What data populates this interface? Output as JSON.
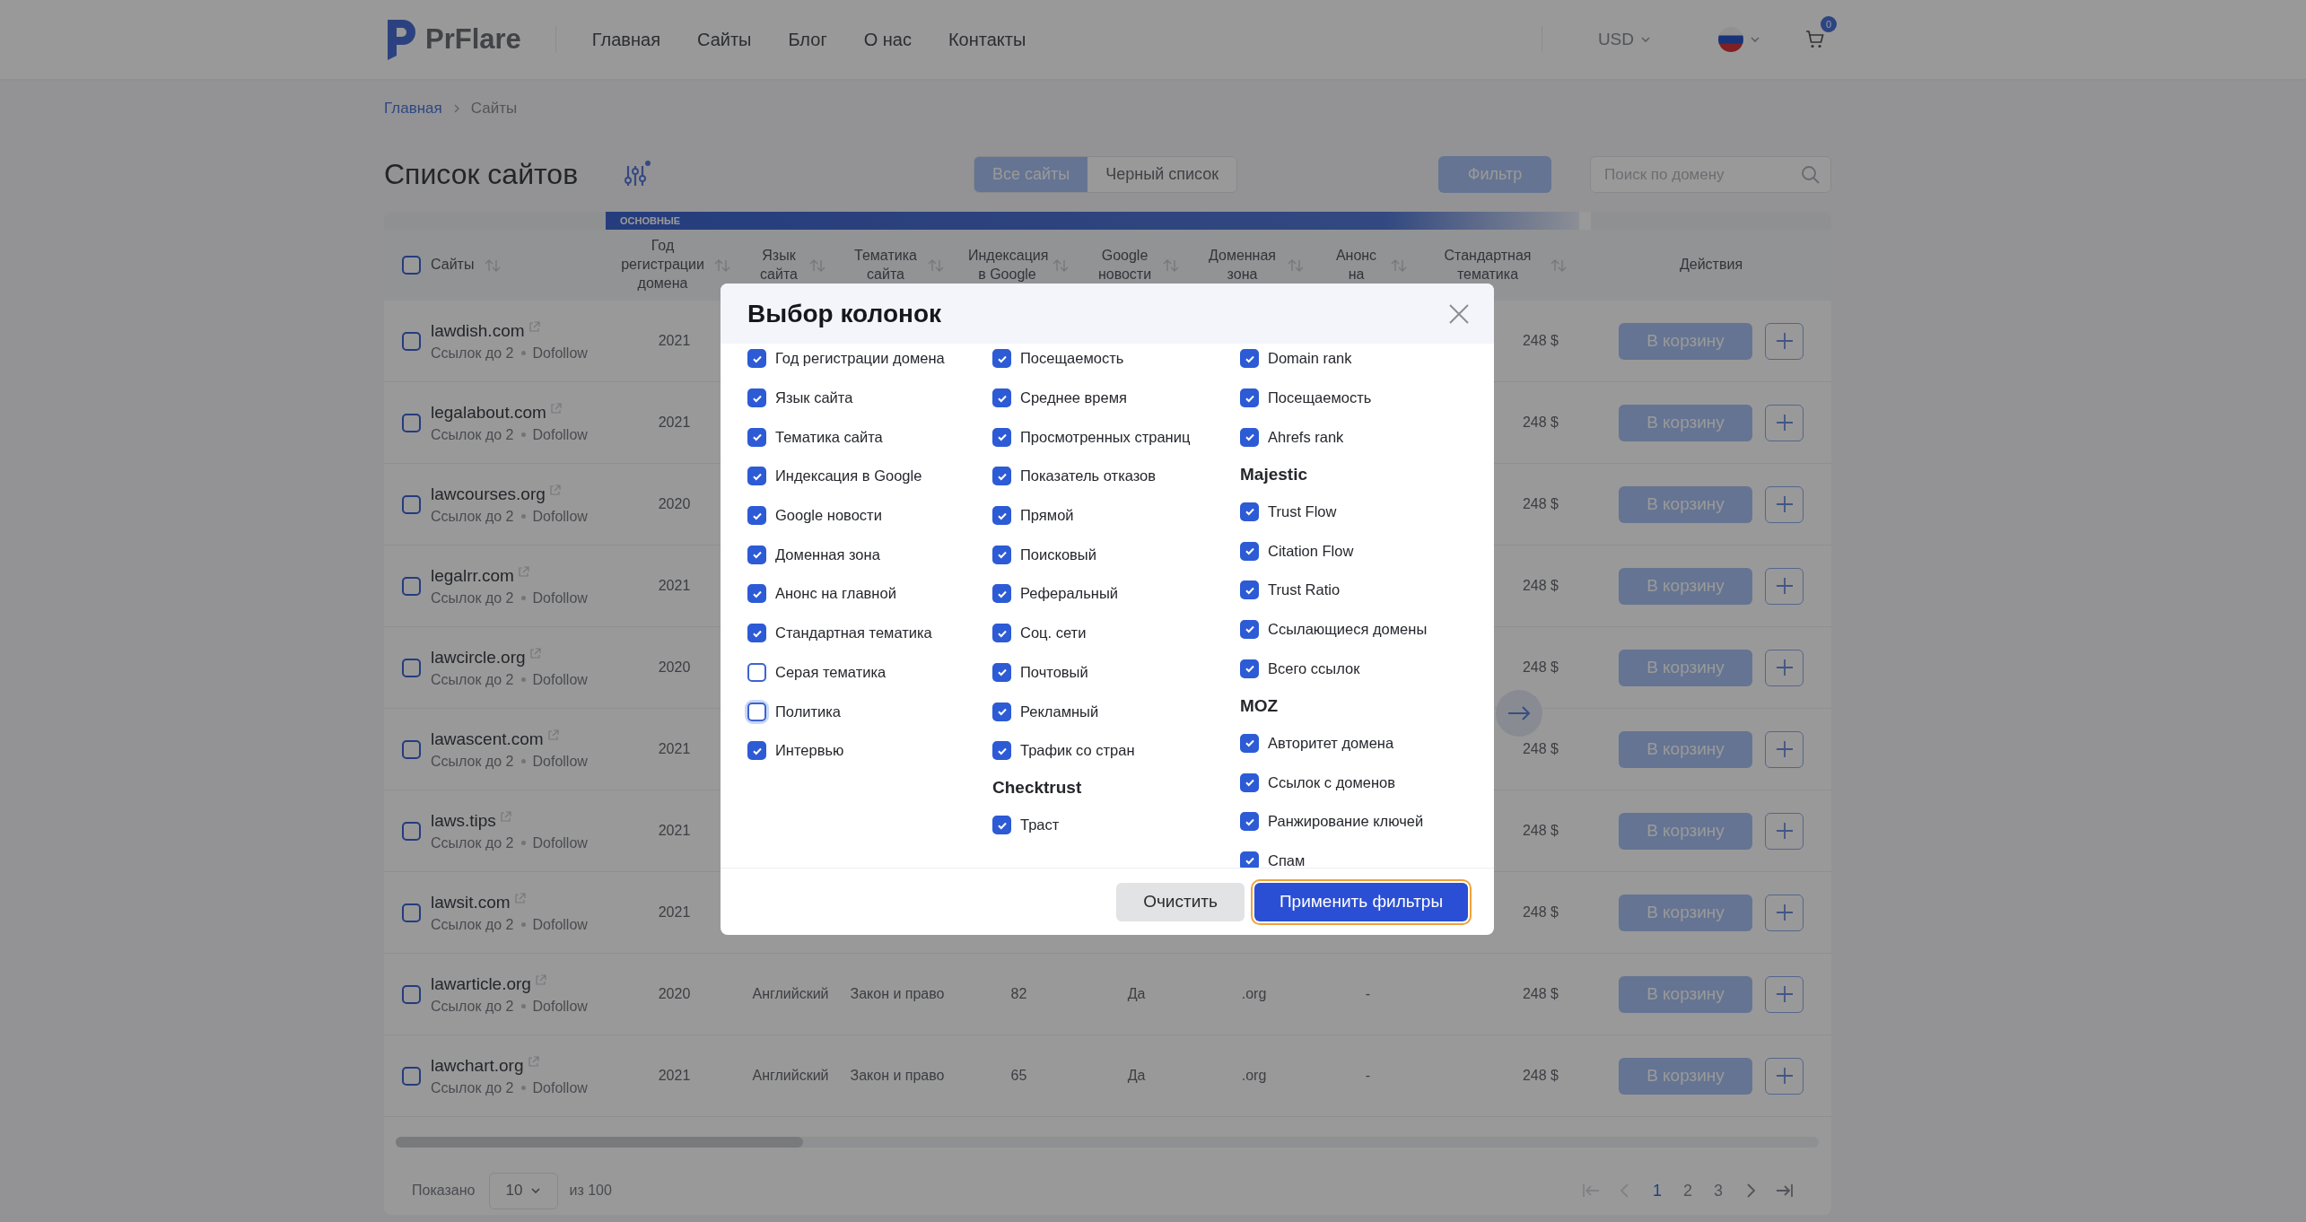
{
  "header": {
    "logo": "PrFlare",
    "nav": [
      {
        "label": "Главная"
      },
      {
        "label": "Сайты"
      },
      {
        "label": "Блог"
      },
      {
        "label": "О нас"
      },
      {
        "label": "Контакты"
      }
    ],
    "currency": "USD",
    "cart_count": "0"
  },
  "breadcrumbs": [
    {
      "label": "Главная",
      "kind": "link"
    },
    {
      "label": "Сайты",
      "kind": "current"
    }
  ],
  "page_title": "Список сайтов",
  "view_tabs": [
    {
      "label": "Все сайты",
      "selected": true
    },
    {
      "label": "Черный список",
      "selected": false
    }
  ],
  "filter_button": "Фильтр",
  "search": {
    "placeholder": "Поиск по домену"
  },
  "table": {
    "group_label": "ОСНОВНЫЕ",
    "select_all_checked": false,
    "columns": [
      "Сайты",
      "Год регистрации домена",
      "Язык сайта",
      "Тематика сайта",
      "Индексация в Google",
      "Google новости",
      "Доменная зона",
      "Анонс на",
      "Стандартная тематика",
      "Действия"
    ],
    "rows": [
      {
        "site": "lawdish.com",
        "links": "Ссылок до 2",
        "follow": "Dofollow",
        "checked": false,
        "year": "2021",
        "price": "248 $",
        "action": "В корзину"
      },
      {
        "site": "legalabout.com",
        "links": "Ссылок до 2",
        "follow": "Dofollow",
        "checked": false,
        "year": "2021",
        "price": "248 $",
        "action": "В корзину"
      },
      {
        "site": "lawcourses.org",
        "links": "Ссылок до 2",
        "follow": "Dofollow",
        "checked": false,
        "year": "2020",
        "price": "248 $",
        "action": "В корзину"
      },
      {
        "site": "legalrr.com",
        "links": "Ссылок до 2",
        "follow": "Dofollow",
        "checked": false,
        "year": "2021",
        "price": "248 $",
        "action": "В корзину"
      },
      {
        "site": "lawcircle.org",
        "links": "Ссылок до 2",
        "follow": "Dofollow",
        "checked": false,
        "year": "2020",
        "price": "248 $",
        "action": "В корзину"
      },
      {
        "site": "lawascent.com",
        "links": "Ссылок до 2",
        "follow": "Dofollow",
        "checked": false,
        "year": "2021",
        "price": "248 $",
        "action": "В корзину"
      },
      {
        "site": "laws.tips",
        "links": "Ссылок до 2",
        "follow": "Dofollow",
        "checked": false,
        "year": "2021",
        "price": "248 $",
        "action": "В корзину"
      },
      {
        "site": "lawsit.com",
        "links": "Ссылок до 2",
        "follow": "Dofollow",
        "checked": false,
        "year": "2021",
        "price": "248 $",
        "action": "В корзину"
      },
      {
        "site": "lawarticle.org",
        "links": "Ссылок до 2",
        "follow": "Dofollow",
        "checked": false,
        "year": "2020",
        "language": "Английский",
        "topic": "Закон и право",
        "indexed": "82",
        "google_news": "Да",
        "zone": ".org",
        "announce": "-",
        "price": "248 $",
        "action": "В корзину"
      },
      {
        "site": "lawchart.org",
        "links": "Ссылок до 2",
        "follow": "Dofollow",
        "checked": false,
        "year": "2021",
        "language": "Английский",
        "topic": "Закон и право",
        "indexed": "65",
        "google_news": "Да",
        "zone": ".org",
        "announce": "-",
        "price": "248 $",
        "action": "В корзину"
      }
    ]
  },
  "pagination": {
    "shown_label": "Показано",
    "per_page": "10",
    "total": "из 100",
    "nav_back": [
      {
        "kind": "first",
        "disabled": true
      },
      {
        "kind": "prev",
        "disabled": true
      }
    ],
    "pages": [
      {
        "label": "1",
        "selected": true
      },
      {
        "label": "2",
        "selected": false
      },
      {
        "label": "3",
        "selected": false
      }
    ],
    "nav_forward": [
      {
        "kind": "next",
        "disabled": false
      },
      {
        "kind": "last",
        "disabled": false
      }
    ]
  },
  "modal": {
    "title": "Выбор колонок",
    "columns": [
      {
        "groups": [
          {
            "items": [
              {
                "label": "Год регистрации домена",
                "checked": true,
                "focused": false
              },
              {
                "label": "Язык сайта",
                "checked": true,
                "focused": false
              },
              {
                "label": "Тематика сайта",
                "checked": true,
                "focused": false
              },
              {
                "label": "Индексация в Google",
                "checked": true,
                "focused": false
              },
              {
                "label": "Google новости",
                "checked": true,
                "focused": false
              },
              {
                "label": "Доменная зона",
                "checked": true,
                "focused": false
              },
              {
                "label": "Анонс на главной",
                "checked": true,
                "focused": false
              },
              {
                "label": "Стандартная тематика",
                "checked": true,
                "focused": false
              },
              {
                "label": "Серая тематика",
                "checked": false,
                "focused": false
              },
              {
                "label": "Политика",
                "checked": false,
                "focused": true
              },
              {
                "label": "Интервью",
                "checked": true,
                "focused": false
              }
            ]
          }
        ]
      },
      {
        "groups": [
          {
            "items": [
              {
                "label": "Посещаемость",
                "checked": true,
                "focused": false
              },
              {
                "label": "Среднее время",
                "checked": true,
                "focused": false
              },
              {
                "label": "Просмотренных страниц",
                "checked": true,
                "focused": false
              },
              {
                "label": "Показатель отказов",
                "checked": true,
                "focused": false
              },
              {
                "label": "Прямой",
                "checked": true,
                "focused": false
              },
              {
                "label": "Поисковый",
                "checked": true,
                "focused": false
              },
              {
                "label": "Реферальный",
                "checked": true,
                "focused": false
              },
              {
                "label": "Соц. сети",
                "checked": true,
                "focused": false
              },
              {
                "label": "Почтовый",
                "checked": true,
                "focused": false
              },
              {
                "label": "Рекламный",
                "checked": true,
                "focused": false
              },
              {
                "label": "Трафик со стран",
                "checked": true,
                "focused": false
              }
            ]
          },
          {
            "heading": "Checktrust",
            "items": [
              {
                "label": "Траст",
                "checked": true,
                "focused": false
              }
            ]
          }
        ]
      },
      {
        "groups": [
          {
            "items": [
              {
                "label": "Domain rank",
                "checked": true,
                "focused": false
              },
              {
                "label": "Посещаемость",
                "checked": true,
                "focused": false
              },
              {
                "label": "Ahrefs rank",
                "checked": true,
                "focused": false
              }
            ]
          },
          {
            "heading": "Majestic",
            "items": [
              {
                "label": "Trust Flow",
                "checked": true,
                "focused": false
              },
              {
                "label": "Citation Flow",
                "checked": true,
                "focused": false
              },
              {
                "label": "Trust Ratio",
                "checked": true,
                "focused": false
              },
              {
                "label": "Ссылающиеся домены",
                "checked": true,
                "focused": false
              },
              {
                "label": "Всего ссылок",
                "checked": true,
                "focused": false
              }
            ]
          },
          {
            "heading": "MOZ",
            "items": [
              {
                "label": "Авторитет домена",
                "checked": true,
                "focused": false
              },
              {
                "label": "Ссылок с доменов",
                "checked": true,
                "focused": false
              },
              {
                "label": "Ранжирование ключей",
                "checked": true,
                "focused": false
              },
              {
                "label": "Спам",
                "checked": true,
                "focused": false
              }
            ]
          }
        ]
      }
    ],
    "buttons": [
      {
        "label": "Очистить",
        "kind": "secondary",
        "focused": false
      },
      {
        "label": "Применить фильтры",
        "kind": "primary",
        "focused": true
      }
    ]
  }
}
